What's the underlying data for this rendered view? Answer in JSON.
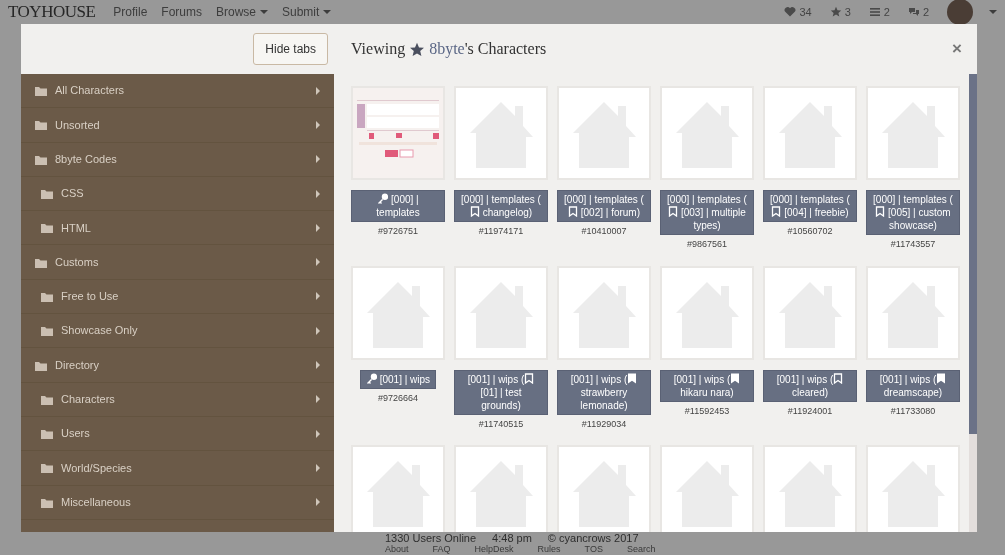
{
  "navbar": {
    "logo": "TOYHOUSE",
    "links": [
      {
        "label": "Profile",
        "dropdown": false
      },
      {
        "label": "Forums",
        "dropdown": false
      },
      {
        "label": "Browse",
        "dropdown": true
      },
      {
        "label": "Submit",
        "dropdown": true
      }
    ],
    "counters": [
      {
        "kind": "heart",
        "count": "34"
      },
      {
        "kind": "star",
        "count": "3"
      },
      {
        "kind": "list",
        "count": "2"
      },
      {
        "kind": "chat",
        "count": "2"
      }
    ]
  },
  "modal": {
    "hide_tabs_button": "Hide tabs",
    "title": {
      "prefix": "Viewing",
      "user": "8byte",
      "suffix": "'s Characters"
    },
    "close": "×"
  },
  "folders": [
    {
      "label": "All Characters"
    },
    {
      "label": "Unsorted"
    },
    {
      "label": "8byte Codes",
      "children": [
        {
          "label": "CSS"
        },
        {
          "label": "HTML"
        }
      ]
    },
    {
      "label": "Customs",
      "children": [
        {
          "label": "Free to Use"
        },
        {
          "label": "Showcase Only"
        }
      ]
    },
    {
      "label": "Directory",
      "children": [
        {
          "label": "Characters"
        },
        {
          "label": "Users"
        },
        {
          "label": "World/Species"
        },
        {
          "label": "Miscellaneous"
        }
      ]
    }
  ],
  "characters": [
    {
      "kind": "key",
      "after": " [000] | templates",
      "number": "#9726751"
    },
    {
      "thumbnail": {
        "kind": "placeholder"
      },
      "before": "[000] | templates (",
      "kind": "bookmark",
      "filled": false,
      "after": " changelog)",
      "number": "#11974171"
    },
    {
      "thumbnail": {
        "kind": "placeholder"
      },
      "before": "[000] | templates (",
      "kind": "bookmark",
      "filled": false,
      "after": " [002] | forum)",
      "number": "#10410007"
    },
    {
      "thumbnail": {
        "kind": "placeholder"
      },
      "before": "[000] | templates (",
      "kind": "bookmark",
      "filled": false,
      "after": " [003] | multiple types)",
      "number": "#9867561"
    },
    {
      "thumbnail": {
        "kind": "placeholder"
      },
      "before": "[000] | templates (",
      "kind": "bookmark",
      "filled": false,
      "after": " [004] | freebie)",
      "number": "#10560702"
    },
    {
      "thumbnail": {
        "kind": "placeholder"
      },
      "before": "[000] | templates (",
      "kind": "bookmark",
      "filled": false,
      "after": " [005] | custom showcase)",
      "number": "#11743557"
    },
    {
      "thumbnail": {
        "kind": "placeholder"
      },
      "kind": "key",
      "after": " [001] | wips",
      "number": "#9726664"
    },
    {
      "thumbnail": {
        "kind": "placeholder"
      },
      "before": "[001] | wips (",
      "kind": "bookmark",
      "filled": false,
      "after": " [01] | test grounds)",
      "number": "#11740515"
    },
    {
      "thumbnail": {
        "kind": "placeholder"
      },
      "before": "[001] | wips (",
      "kind": "bookmark",
      "filled": true,
      "after": " strawberry lemonade)",
      "number": "#11929034"
    },
    {
      "thumbnail": {
        "kind": "placeholder"
      },
      "before": "[001] | wips (",
      "kind": "bookmark",
      "filled": true,
      "after": " hikaru nara)",
      "number": "#11592453"
    },
    {
      "thumbnail": {
        "kind": "placeholder"
      },
      "before": "[001] | wips (",
      "kind": "bookmark",
      "filled": false,
      "after": " cleared)",
      "number": "#11924001"
    },
    {
      "thumbnail": {
        "kind": "placeholder"
      },
      "before": "[001] | wips (",
      "kind": "bookmark",
      "filled": true,
      "after": " dreamscape)",
      "number": "#11733080"
    },
    {
      "thumbnail": {
        "kind": "placeholder"
      }
    },
    {
      "thumbnail": {
        "kind": "placeholder"
      }
    },
    {
      "thumbnail": {
        "kind": "placeholder"
      }
    },
    {
      "thumbnail": {
        "kind": "placeholder"
      }
    },
    {
      "thumbnail": {
        "kind": "placeholder"
      }
    },
    {
      "thumbnail": {
        "kind": "placeholder"
      }
    }
  ],
  "footer": {
    "stats": [
      "1330 Users Online",
      "4:48 pm",
      "© cyancrows 2017"
    ],
    "links": [
      "About",
      "FAQ",
      "HelpDesk",
      "Rules",
      "TOS",
      "Search"
    ]
  }
}
